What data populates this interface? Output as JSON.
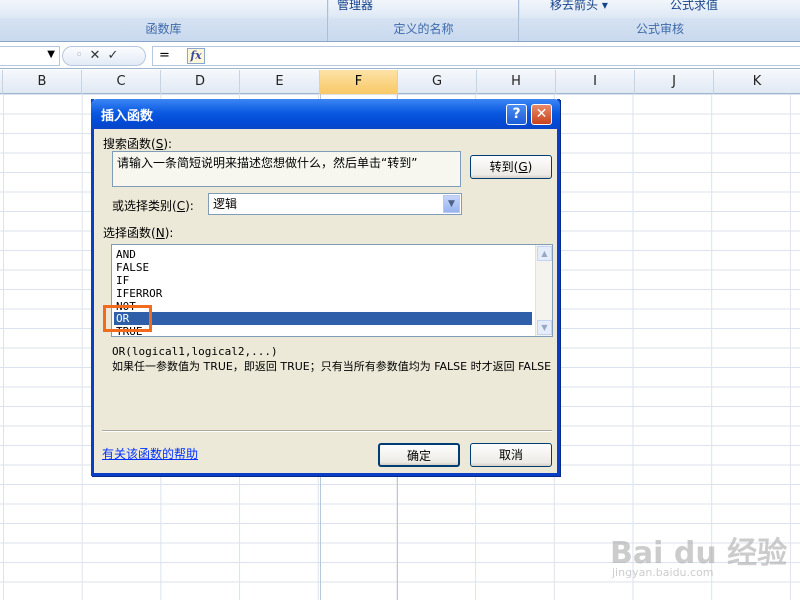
{
  "ribbon": {
    "groups": [
      {
        "cut_text": "",
        "name": "函数库"
      },
      {
        "cut_text": "管理器",
        "name": "定义的名称"
      },
      {
        "cut_text": "移去箭头 ▾",
        "cut_text2": "公式求值",
        "name": "公式审核"
      }
    ]
  },
  "formula_bar": {
    "namebox_value": "",
    "cancel_symbol": "✕",
    "enter_symbol": "✓",
    "fx_label": "fx",
    "content": "="
  },
  "columns": [
    "B",
    "C",
    "D",
    "E",
    "F",
    "G",
    "H",
    "I",
    "J",
    "K"
  ],
  "selected_column": "F",
  "dialog": {
    "title": "插入函数",
    "help_symbol": "?",
    "close_symbol": "✕",
    "search_label": "搜索函数",
    "search_key": "S",
    "search_text": "请输入一条简短说明来描述您想做什么，然后单击“转到”",
    "go_button": "转到",
    "go_key": "G",
    "category_label": "或选择类别",
    "category_key": "C",
    "category_value": "逻辑",
    "list_label": "选择函数",
    "list_key": "N",
    "functions": [
      "AND",
      "FALSE",
      "IF",
      "IFERROR",
      "NOT",
      "OR",
      "TRUE"
    ],
    "selected_function": "OR",
    "syntax": "OR(logical1,logical2,...)",
    "description": "如果任一参数值为 TRUE，即返回 TRUE；只有当所有参数值均为 FALSE 时才返回 FALSE",
    "help_link": "有关该函数的帮助",
    "ok_button": "确定",
    "cancel_button": "取消"
  },
  "watermark": {
    "text": "Bai du 经验",
    "url_text": "jingyan.baidu.com"
  }
}
